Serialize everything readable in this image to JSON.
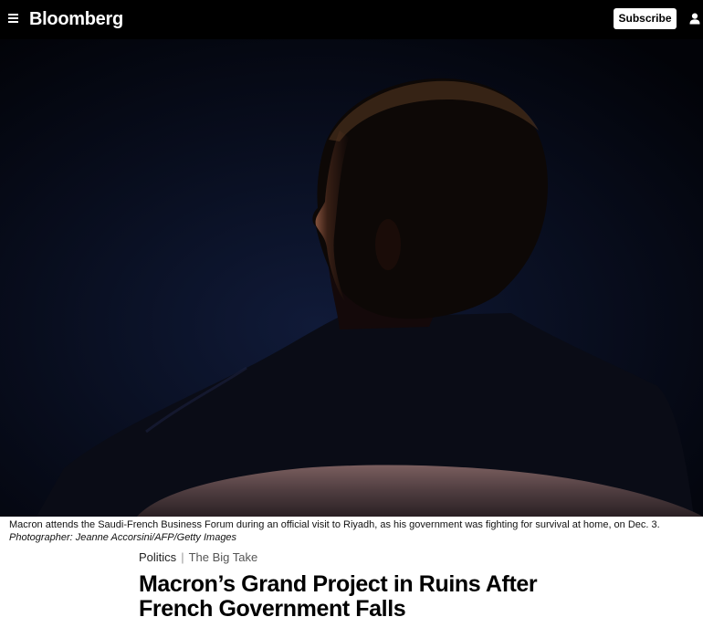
{
  "header": {
    "brand": "Bloomberg",
    "subscribe_label": "Subscribe",
    "menu_icon": "hamburger-menu-icon",
    "account_icon": "person-icon",
    "background_color": "#000000"
  },
  "hero": {
    "caption_text": "Macron attends the Saudi-French Business Forum during an official visit to Riyadh, as his government was fighting for survival at home, on Dec. 3.",
    "photographer_credit": "Photographer: Jeanne Accorsini/AFP/Getty Images"
  },
  "article": {
    "section": "Politics",
    "separator": "|",
    "series": "The Big Take",
    "headline": "Macron’s Grand Project in Ruins After French Government Falls"
  }
}
